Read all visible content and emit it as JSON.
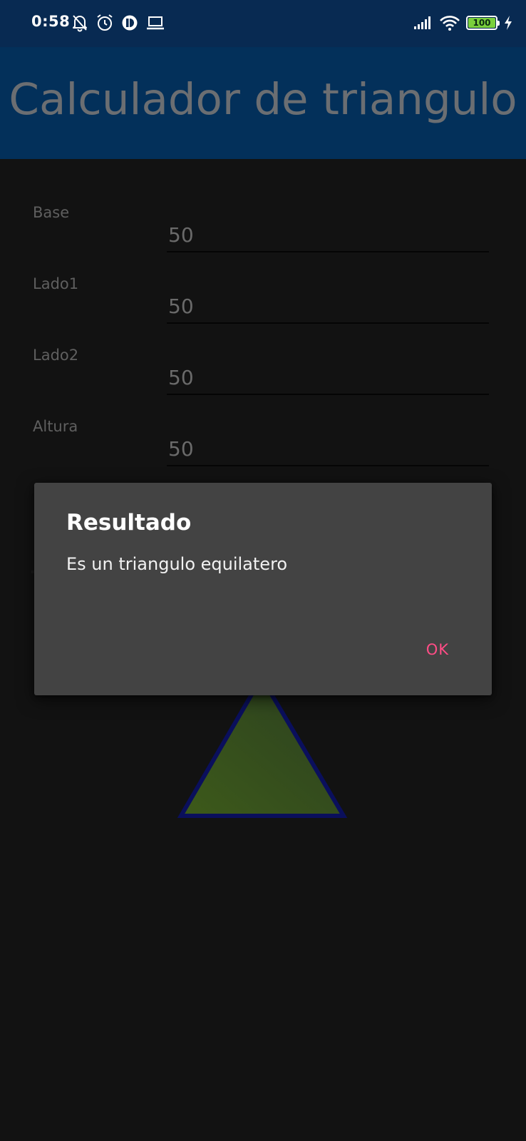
{
  "status_bar": {
    "time": "0:58",
    "battery_level": "100",
    "background_color": "#082a52",
    "icons_left": [
      "muted-bell-icon",
      "alarm-icon",
      "app-notification-icon",
      "laptop-icon"
    ],
    "icons_right": [
      "signal-icon",
      "wifi-icon",
      "battery-icon",
      "charging-icon"
    ]
  },
  "app_bar": {
    "title": "Calculador de triangulo",
    "background_color": "#03305a"
  },
  "form": {
    "fields": [
      {
        "label": "Base",
        "value": "50"
      },
      {
        "label": "Lado1",
        "value": "50"
      },
      {
        "label": "Lado2",
        "value": "50"
      },
      {
        "label": "Altura",
        "value": "50"
      }
    ]
  },
  "triangle": {
    "fill_color": "#3a4f1c",
    "stroke_color": "#0a0f5c"
  },
  "dialog": {
    "title": "Resultado",
    "message": "Es un triangulo equilatero",
    "ok_label": "OK",
    "accent_color": "#ff4d86"
  }
}
